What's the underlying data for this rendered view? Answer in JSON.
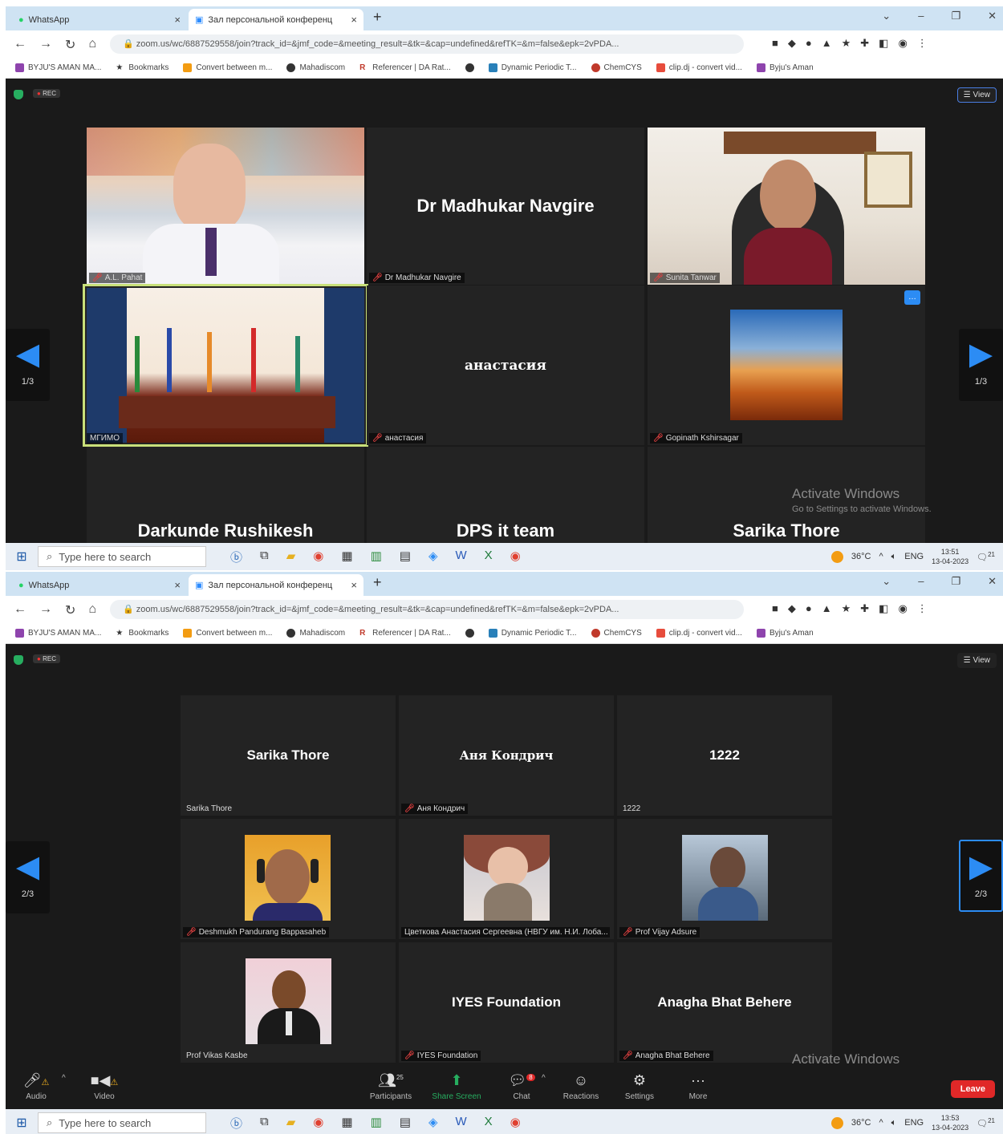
{
  "browser": {
    "tab1": {
      "title": "WhatsApp",
      "close": "×"
    },
    "tab2": {
      "title": "Зал персональной конференц",
      "close": "×"
    },
    "newtab": "+",
    "url": "zoom.us/wc/6887529558/join?track_id=&jmf_code=&meeting_result=&tk=&cap=undefined&refTK=&m=false&epk=2vPDA...",
    "bookmarks": [
      "BYJU'S AMAN MA...",
      "Bookmarks",
      "Convert between m...",
      "Mahadiscom",
      "Referencer | DA Rat...",
      "Dynamic Periodic T...",
      "ChemCYS",
      "clip.dj - convert vid...",
      "Byju's Aman"
    ]
  },
  "zoom": {
    "rec": "REC",
    "view": "View",
    "page1": "1/3",
    "page2": "2/3",
    "activate_title": "Activate Windows",
    "activate_sub": "Go to Settings to activate Windows.",
    "leave": "Leave"
  },
  "screen1_tiles": [
    {
      "name": "",
      "label": "A.L. Pahat"
    },
    {
      "name": "Dr Madhukar Navgire",
      "label": "Dr Madhukar Navgire"
    },
    {
      "name": "",
      "label": "Sunita Tanwar"
    },
    {
      "name": "",
      "label": "МГИМО"
    },
    {
      "name": "анастасия",
      "label": "анастасия"
    },
    {
      "name": "",
      "label": "Gopinath Kshirsagar"
    },
    {
      "name": "Darkunde Rushikesh",
      "label": ""
    },
    {
      "name": "DPS it team",
      "label": ""
    },
    {
      "name": "Sarika Thore",
      "label": ""
    }
  ],
  "screen2_tiles": [
    {
      "name": "Sarika Thore",
      "label": "Sarika Thore"
    },
    {
      "name": "Аня Кондрич",
      "label": "Аня Кондрич"
    },
    {
      "name": "1222",
      "label": "1222"
    },
    {
      "name": "",
      "label": "Deshmukh Pandurang Bappasaheb"
    },
    {
      "name": "",
      "label": "Цветкова Анастасия Сергеевна (НВГУ им. Н.И. Лоба..."
    },
    {
      "name": "",
      "label": "Prof Vijay Adsure"
    },
    {
      "name": "",
      "label": "Prof Vikas Kasbe"
    },
    {
      "name": "IYES Foundation",
      "label": "IYES Foundation"
    },
    {
      "name": "Anagha Bhat Behere",
      "label": "Anagha Bhat Behere"
    }
  ],
  "controls": {
    "audio": "Audio",
    "video": "Video",
    "participants": "Participants",
    "participants_count": "25",
    "share": "Share Screen",
    "chat": "Chat",
    "chat_badge": "8",
    "reactions": "Reactions",
    "settings": "Settings",
    "more": "More"
  },
  "taskbar": {
    "search": "Type here to search",
    "temp": "36°C",
    "lang": "ENG",
    "time1": "13:51",
    "time2": "13:53",
    "date": "13-04-2023",
    "notif": "21"
  },
  "colors": {
    "accent": "#2c8cf4",
    "active_speaker": "#c8e07a",
    "leave": "#e02828"
  }
}
